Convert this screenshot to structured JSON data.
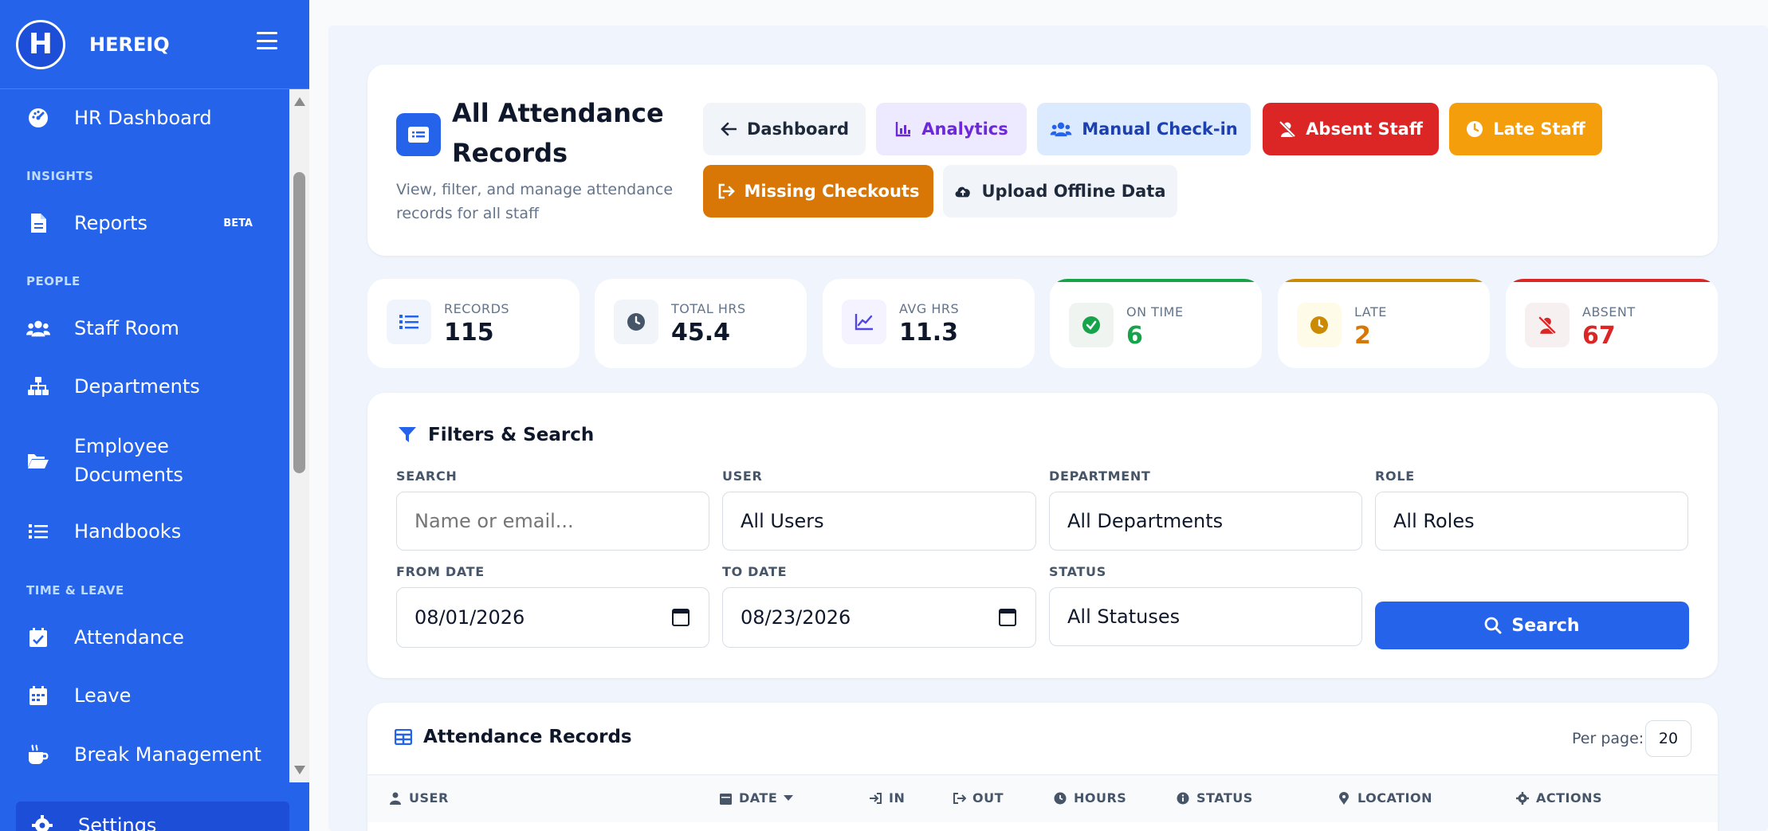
{
  "app": {
    "name": "HEREIQ",
    "logo_letter": "H"
  },
  "sidebar": {
    "items": [
      {
        "label": "HR Dashboard",
        "icon": "gauge-icon"
      },
      {
        "label": "Reports",
        "icon": "file-icon",
        "badge": "BETA"
      },
      {
        "label": "Staff Room",
        "icon": "users-icon"
      },
      {
        "label": "Departments",
        "icon": "sitemap-icon"
      },
      {
        "label": "Employee Documents",
        "icon": "folder-open-icon"
      },
      {
        "label": "Handbooks",
        "icon": "list-icon"
      },
      {
        "label": "Attendance",
        "icon": "calendar-check-icon"
      },
      {
        "label": "Leave",
        "icon": "calendar-icon"
      },
      {
        "label": "Break Management",
        "icon": "coffee-icon"
      },
      {
        "label": "Settings",
        "icon": "gear-icon"
      }
    ],
    "sections": {
      "insights": "INSIGHTS",
      "people": "PEOPLE",
      "time_leave": "TIME & LEAVE"
    }
  },
  "header": {
    "title": "All Attendance Records",
    "subtitle": "View, filter, and manage attendance records for all staff",
    "buttons": {
      "dashboard": "Dashboard",
      "analytics": "Analytics",
      "manual_checkin": "Manual Check-in",
      "absent_staff": "Absent Staff",
      "late_staff": "Late Staff",
      "missing_checkouts": "Missing Checkouts",
      "upload_offline": "Upload Offline Data"
    }
  },
  "stats": [
    {
      "label": "RECORDS",
      "value": "115",
      "color": "#0f172a"
    },
    {
      "label": "TOTAL HRS",
      "value": "45.4",
      "color": "#0f172a"
    },
    {
      "label": "AVG HRS",
      "value": "11.3",
      "color": "#0f172a"
    },
    {
      "label": "ON TIME",
      "value": "6",
      "color": "#16a34a"
    },
    {
      "label": "LATE",
      "value": "2",
      "color": "#d97706"
    },
    {
      "label": "ABSENT",
      "value": "67",
      "color": "#dc2626"
    }
  ],
  "filters": {
    "title": "Filters & Search",
    "search": {
      "label": "SEARCH",
      "placeholder": "Name or email..."
    },
    "user": {
      "label": "USER",
      "value": "All Users"
    },
    "department": {
      "label": "DEPARTMENT",
      "value": "All Departments"
    },
    "role": {
      "label": "ROLE",
      "value": "All Roles"
    },
    "from_date": {
      "label": "FROM DATE",
      "value": "08/01/2026"
    },
    "to_date": {
      "label": "TO DATE",
      "value": "08/23/2026"
    },
    "status": {
      "label": "STATUS",
      "value": "All Statuses"
    },
    "search_button": "Search"
  },
  "records": {
    "title": "Attendance Records",
    "per_page_label": "Per page:",
    "per_page_value": "20",
    "columns": [
      "USER",
      "DATE",
      "IN",
      "OUT",
      "HOURS",
      "STATUS",
      "LOCATION",
      "ACTIONS"
    ]
  },
  "colors": {
    "primary": "#2563eb",
    "analytics_bg": "#ede9fe",
    "analytics_fg": "#6d28d9",
    "checkin_bg": "#dbeafe",
    "checkin_fg": "#1e40af",
    "danger": "#dc2626",
    "warning": "#f59e0b",
    "orange": "#d97706",
    "neutral_btn": "#f1f5f9"
  }
}
